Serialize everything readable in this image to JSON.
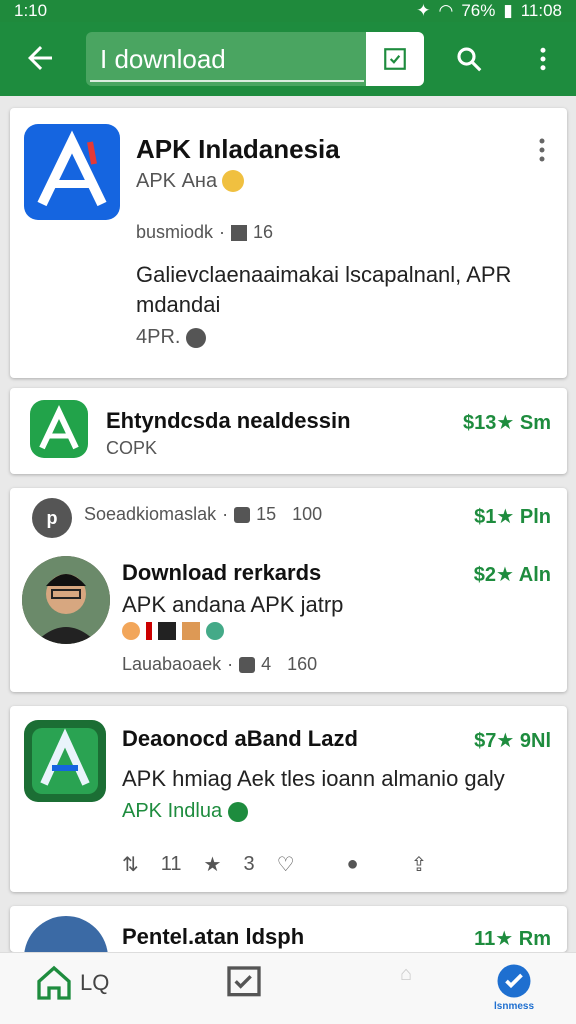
{
  "status": {
    "time": "1:10",
    "battery": "76%",
    "clock": "11:08"
  },
  "appbar": {
    "query": "I download"
  },
  "cards": [
    {
      "title": "APK Inladanesia",
      "subtitle": "APK Ана",
      "meta_left": "busmiodk",
      "meta_count": "16",
      "body1": "Galievclaenaaimakai lscapalnanl, APR",
      "body2": "mdandai",
      "footer": "4PR."
    },
    {
      "title": "Ehtyndcsda nealdessin",
      "subtitle": "COPK",
      "price": "$13★ Sm"
    },
    {
      "header": "Soeadkiomaslak",
      "header_count1": "15",
      "header_count2": "100",
      "title": "Download rerkards",
      "price": "$1★ Pln",
      "price2": "$2★ Aln",
      "body1": "APK andana APK jatrp",
      "meta_left": "Lauabaoaek",
      "meta_count1": "4",
      "meta_count2": "160"
    },
    {
      "title": "Deaonocd aBand Lazd",
      "price": "$7★ 9Nl",
      "body1": "APK hmiag Aek tles ioann almanio galy",
      "developer": "APK Indlua",
      "actions": {
        "a1": "11",
        "a2": "3"
      }
    },
    {
      "title": "Pentel.atan ldsph",
      "price": "11★ Rm"
    }
  ],
  "nav": {
    "lq": "LQ",
    "badge": "lsnmess"
  },
  "colors": {
    "primary": "#1e8c3e",
    "accent": "#1e6fd0"
  }
}
